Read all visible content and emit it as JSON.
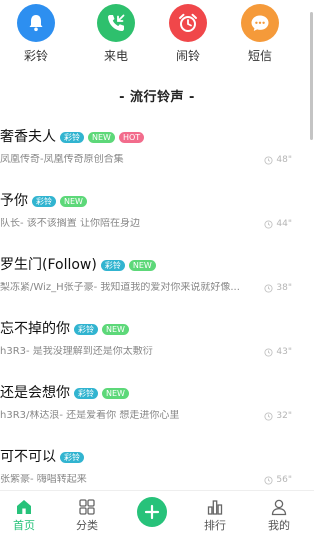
{
  "categories": [
    {
      "label": "彩铃",
      "icon": "bell-icon",
      "color": "#2d8ff0"
    },
    {
      "label": "来电",
      "icon": "incoming-call-icon",
      "color": "#2ec06d"
    },
    {
      "label": "闹铃",
      "icon": "alarm-clock-icon",
      "color": "#f0474a"
    },
    {
      "label": "短信",
      "icon": "message-icon",
      "color": "#f59a3a"
    }
  ],
  "section_title": "- 流行铃声 -",
  "songs": [
    {
      "title": "奢香夫人",
      "badges": [
        "彩铃",
        "NEW",
        "HOT"
      ],
      "subtitle": "凤凰传奇-凤凰传奇原创合集",
      "duration": "48\""
    },
    {
      "title": "予你",
      "badges": [
        "彩铃",
        "NEW"
      ],
      "subtitle": "队长- 该不该搁置 让你陪在身边",
      "duration": "44\""
    },
    {
      "title": "罗生门(Follow)",
      "badges": [
        "彩铃",
        "NEW"
      ],
      "subtitle": "梨冻紧/Wiz_H张子豪- 我知道我的爱对你来说就好像...",
      "duration": "38\""
    },
    {
      "title": "忘不掉的你",
      "badges": [
        "彩铃",
        "NEW"
      ],
      "subtitle": "h3R3- 是我没理解到还是你太敷衍",
      "duration": "43\""
    },
    {
      "title": "还是会想你",
      "badges": [
        "彩铃",
        "NEW"
      ],
      "subtitle": "h3R3/林达浪- 还是爱着你 想走进你心里",
      "duration": "32\""
    },
    {
      "title": "可不可以",
      "badges": [
        "彩铃"
      ],
      "subtitle": "张紫豪- 嗨唱转起来",
      "duration": "56\""
    }
  ],
  "tabbar": {
    "home": "首页",
    "category": "分类",
    "rank": "排行",
    "mine": "我的",
    "accent": "#27c27a"
  }
}
